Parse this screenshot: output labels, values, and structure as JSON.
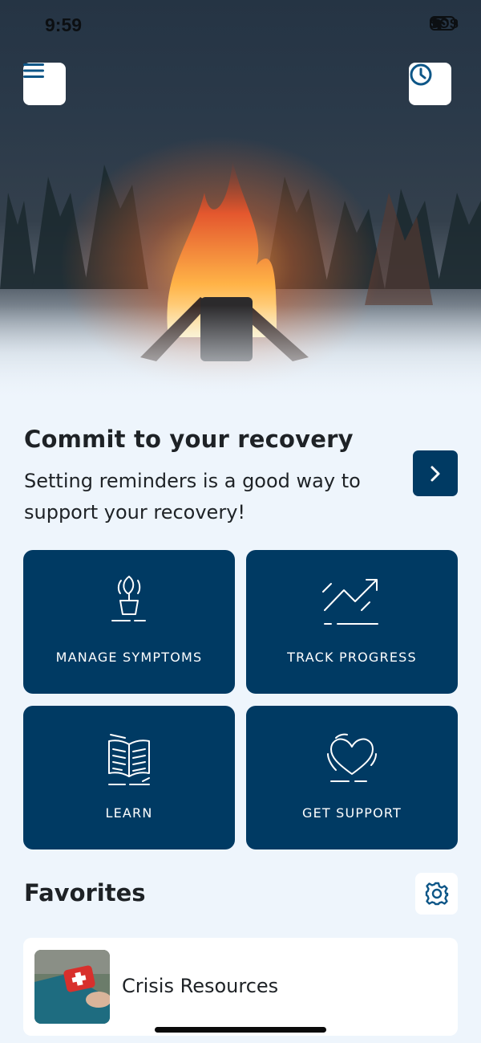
{
  "status_bar": {
    "time": "9:59",
    "sos": "SOS"
  },
  "header": {
    "menu_icon": "hamburger-menu-icon",
    "history_icon": "clock-icon"
  },
  "commit": {
    "title": "Commit to your recovery",
    "text": "Setting reminders is a good way to support your recovery!",
    "arrow_icon": "chevron-right-icon"
  },
  "tiles": [
    {
      "label": "MANAGE SYMPTOMS",
      "icon": "plant-pot-icon"
    },
    {
      "label": "TRACK PROGRESS",
      "icon": "trend-up-icon"
    },
    {
      "label": "LEARN",
      "icon": "open-book-icon"
    },
    {
      "label": "GET SUPPORT",
      "icon": "heart-icon"
    }
  ],
  "favorites": {
    "title": "Favorites",
    "settings_icon": "gear-icon",
    "items": [
      {
        "label": "Crisis Resources",
        "thumb": "first-aid-kit-image"
      }
    ]
  },
  "colors": {
    "primary": "#003a63",
    "background": "#eef5fc",
    "card": "#ffffff",
    "text": "#1e2226"
  }
}
